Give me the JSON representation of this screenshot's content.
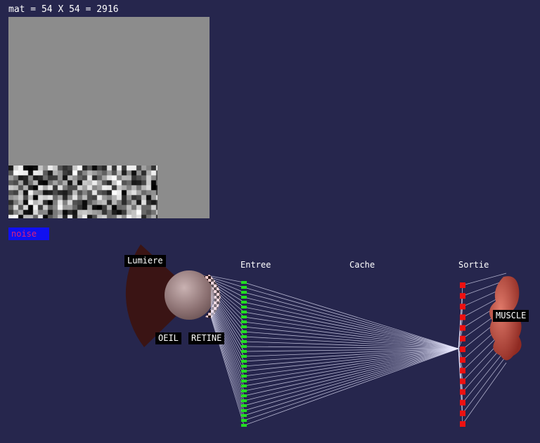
{
  "header": {
    "matrix_info": "mat = 54 X 54 = 2916"
  },
  "controls": {
    "noise_label": "noise"
  },
  "network": {
    "light_label": "Lumiere",
    "eye_label": "OEIL",
    "retina_label": "RETINE",
    "input_label": "Entree",
    "hidden_label": "Cache",
    "output_label": "Sortie",
    "muscle_label": "MUSCLE",
    "input_neuron_count": 30,
    "output_neuron_count": 14
  },
  "colors": {
    "background": "#26264d",
    "input_neuron": "#22dd22",
    "output_neuron": "#ee1111",
    "noise_button": "#1010f0",
    "noise_text": "#e0207a",
    "panel_gray": "#8c8c8c"
  }
}
